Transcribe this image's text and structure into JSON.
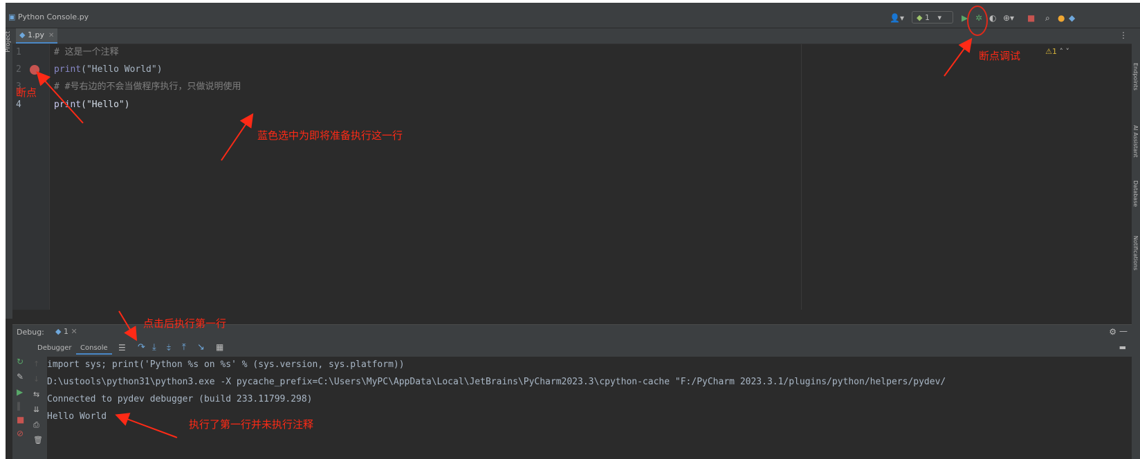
{
  "window": {
    "project_label": "Python Console.py"
  },
  "toolbar": {
    "run_config": "1"
  },
  "sidebars": {
    "left_project": "Project",
    "right_labels": [
      "Endpoints",
      "AI Assistant",
      "Database",
      "Notifications"
    ]
  },
  "editor": {
    "tab_label": "1.py",
    "warnings": "⚠1",
    "lines": [
      {
        "num": "1",
        "text": "# 这是一个注释"
      },
      {
        "num": "2",
        "keyword": "print",
        "text": "(\"Hello World\")"
      },
      {
        "num": "3",
        "text": "# #号右边的不会当做程序执行，只做说明使用"
      },
      {
        "num": "4",
        "keyword": "print",
        "text": "(\"Hello\")"
      }
    ]
  },
  "debug": {
    "label": "Debug:",
    "session": "1",
    "tabs": [
      "Debugger",
      "Console"
    ],
    "console_lines": [
      "import sys; print('Python %s on %s' % (sys.version, sys.platform))",
      "D:\\ustools\\python31\\python3.exe -X pycache_prefix=C:\\Users\\MyPC\\AppData\\Local\\JetBrains\\PyCharm2023.3\\cpython-cache \"F:/PyCharm 2023.3.1/plugins/python/helpers/pydev/",
      "Connected to pydev debugger (build 233.11799.298)",
      "Hello World"
    ]
  },
  "annotations": {
    "debug_button": "断点调试",
    "breakpoint": "断点",
    "selected_line": "蓝色选中为即将准备执行这一行",
    "step_over": "点击后执行第一行",
    "result": "执行了第一行并未执行注释"
  },
  "colors": {
    "annotation": "#ff2a16",
    "selection": "#2f65ca",
    "breakpoint": "#c75450"
  }
}
